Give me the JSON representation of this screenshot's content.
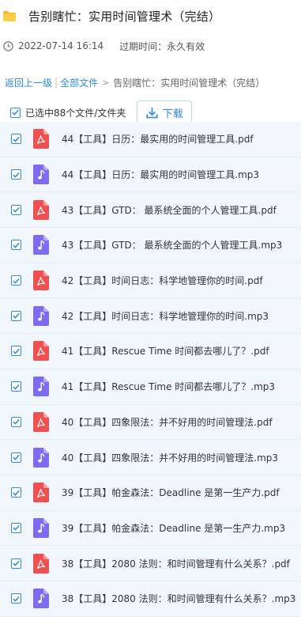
{
  "header": {
    "title": "告别瞎忙：实用时间管理术（完结）",
    "icon": "folder-icon"
  },
  "meta": {
    "date": "2022-07-14 16:14",
    "expire": "过期时间：永久有效"
  },
  "breadcrumb": {
    "back": "返回上一级",
    "sep": "|",
    "all": "全部文件",
    "arrow": ">",
    "current": "告别瞎忙：实用时间管理术（完结）"
  },
  "toolbar": {
    "selected": "已选中88个文件/文件夹",
    "download": "下载"
  },
  "colors": {
    "accent": "#2c8ae8",
    "pdf": "#f0504f",
    "audio": "#7b6cf0",
    "row_bg": "#f1f6fd",
    "folder": "#f5b829"
  },
  "files": [
    {
      "name": "44【工具】日历：最实用的时间管理工具.pdf",
      "type": "pdf"
    },
    {
      "name": "44【工具】日历：最实用的时间管理工具.mp3",
      "type": "audio"
    },
    {
      "name": "43【工具】GTD： 最系统全面的个人管理工具.pdf",
      "type": "pdf"
    },
    {
      "name": "43【工具】GTD： 最系统全面的个人管理工具.mp3",
      "type": "audio"
    },
    {
      "name": "42【工具】时间日志：科学地管理你的时间.pdf",
      "type": "pdf"
    },
    {
      "name": "42【工具】时间日志：科学地管理你的时间.mp3",
      "type": "audio"
    },
    {
      "name": "41【工具】Rescue Time 时间都去哪儿了？.pdf",
      "type": "pdf"
    },
    {
      "name": "41【工具】Rescue Time 时间都去哪儿了？.mp3",
      "type": "audio"
    },
    {
      "name": "40【工具】四象限法：并不好用的时间管理法.pdf",
      "type": "pdf"
    },
    {
      "name": "40【工具】四象限法：并不好用的时间管理法.mp3",
      "type": "audio"
    },
    {
      "name": "39【工具】帕金森法：Deadline 是第一生产力.pdf",
      "type": "pdf"
    },
    {
      "name": "39【工具】帕金森法：Deadline 是第一生产力.mp3",
      "type": "audio"
    },
    {
      "name": "38【工具】2080 法则：和时间管理有什么关系？.pdf",
      "type": "pdf"
    },
    {
      "name": "38【工具】2080 法则：和时间管理有什么关系？.mp3",
      "type": "audio"
    }
  ]
}
